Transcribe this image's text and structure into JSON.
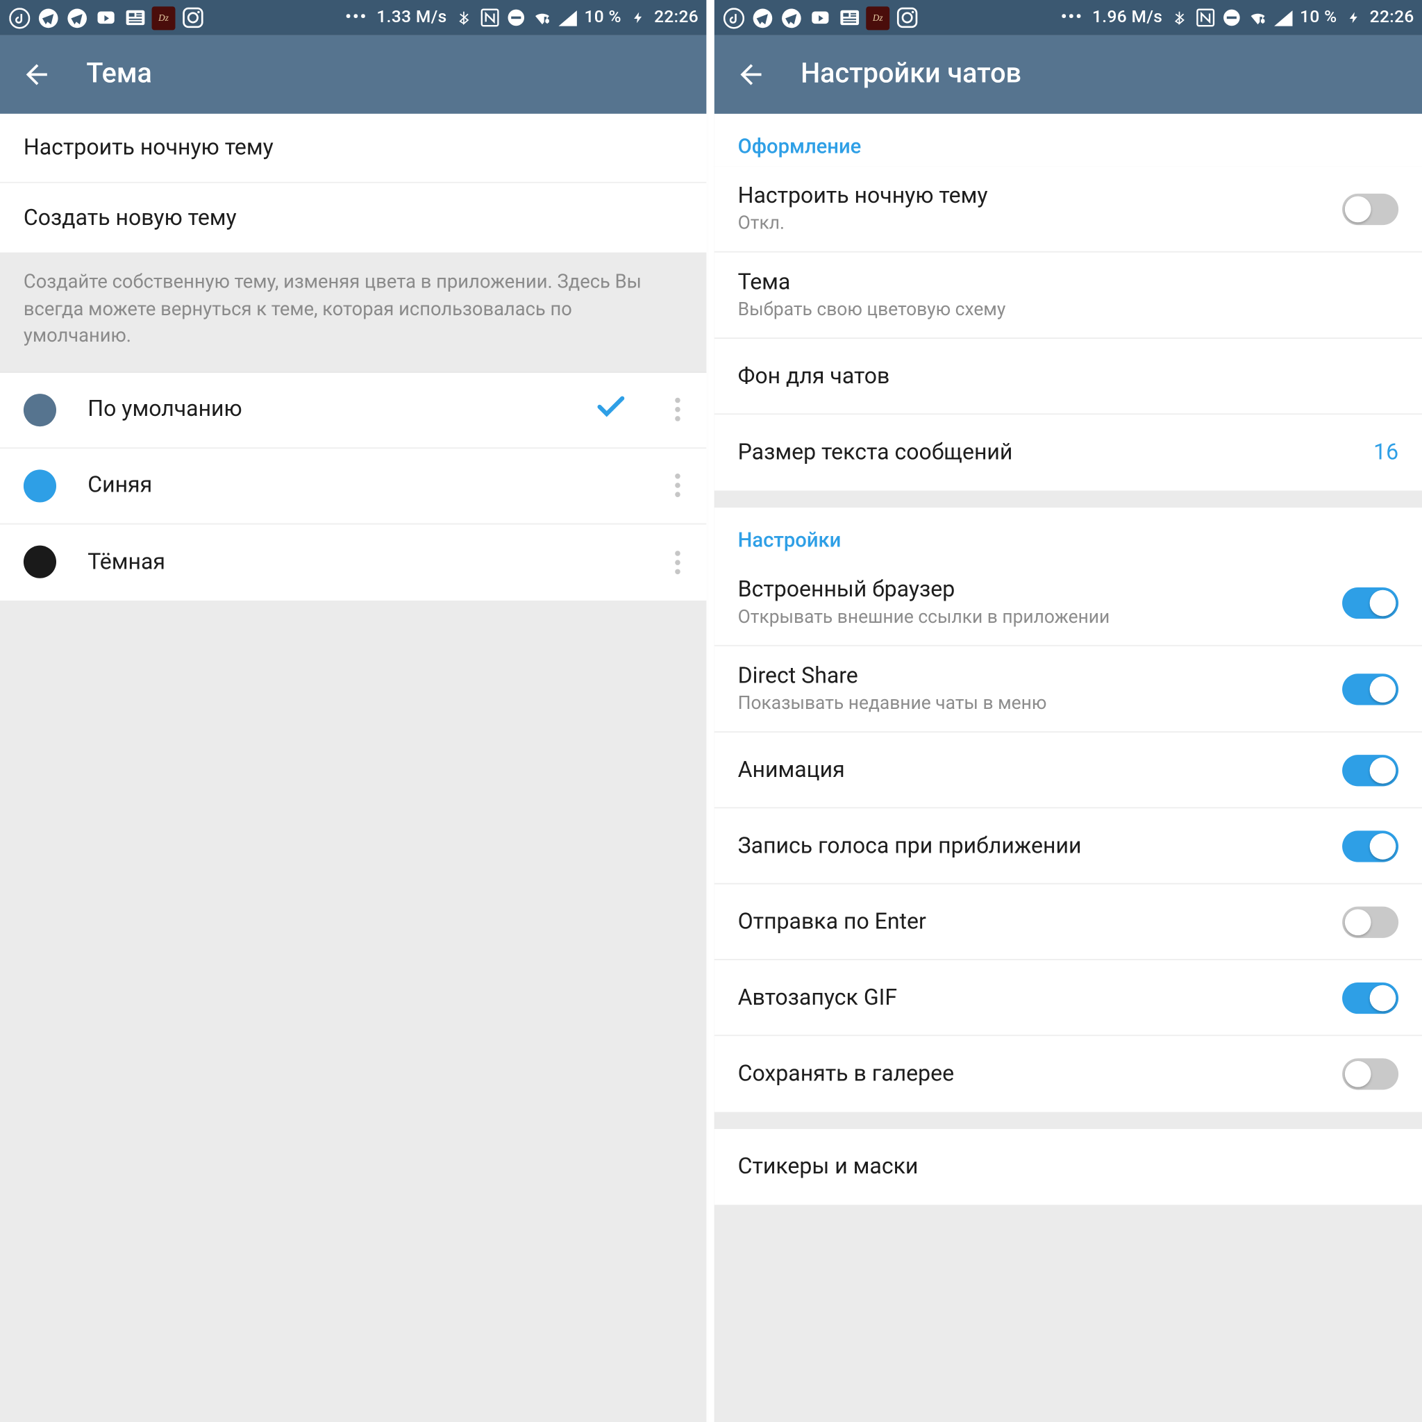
{
  "status": {
    "net_left": "1.33 M/s",
    "net_right": "1.96 M/s",
    "battery": "10 %",
    "time": "22:26"
  },
  "left": {
    "title": "Тема",
    "items": [
      {
        "label": "Настроить ночную тему"
      },
      {
        "label": "Создать новую тему"
      }
    ],
    "hint": "Создайте собственную тему, изменяя цвета в приложении. Здесь Вы всегда можете вернуться к теме, которая использовалась по умолчанию.",
    "themes": [
      {
        "label": "По умолчанию",
        "color": "#56748f",
        "checked": true
      },
      {
        "label": "Синяя",
        "color": "#2e9fe6",
        "checked": false
      },
      {
        "label": "Тёмная",
        "color": "#1a1a1a",
        "checked": false
      }
    ]
  },
  "right": {
    "title": "Настройки чатов",
    "section1": "Оформление",
    "night": {
      "title": "Настроить ночную тему",
      "sub": "Откл.",
      "on": false
    },
    "theme": {
      "title": "Тема",
      "sub": "Выбрать свою цветовую схему"
    },
    "bg": {
      "title": "Фон для чатов"
    },
    "textsize": {
      "title": "Размер текста сообщений",
      "value": "16"
    },
    "section2": "Настройки",
    "browser": {
      "title": "Встроенный браузер",
      "sub": "Открывать внешние ссылки в приложении",
      "on": true
    },
    "dshare": {
      "title": "Direct Share",
      "sub": "Показывать недавние чаты в меню",
      "on": true
    },
    "anim": {
      "title": "Анимация",
      "on": true
    },
    "voice": {
      "title": "Запись голоса при приближении",
      "on": true
    },
    "enter": {
      "title": "Отправка по Enter",
      "on": false
    },
    "gif": {
      "title": "Автозапуск GIF",
      "on": true
    },
    "gallery": {
      "title": "Сохранять в галерее",
      "on": false
    },
    "stickers": "Стикеры и маски"
  }
}
